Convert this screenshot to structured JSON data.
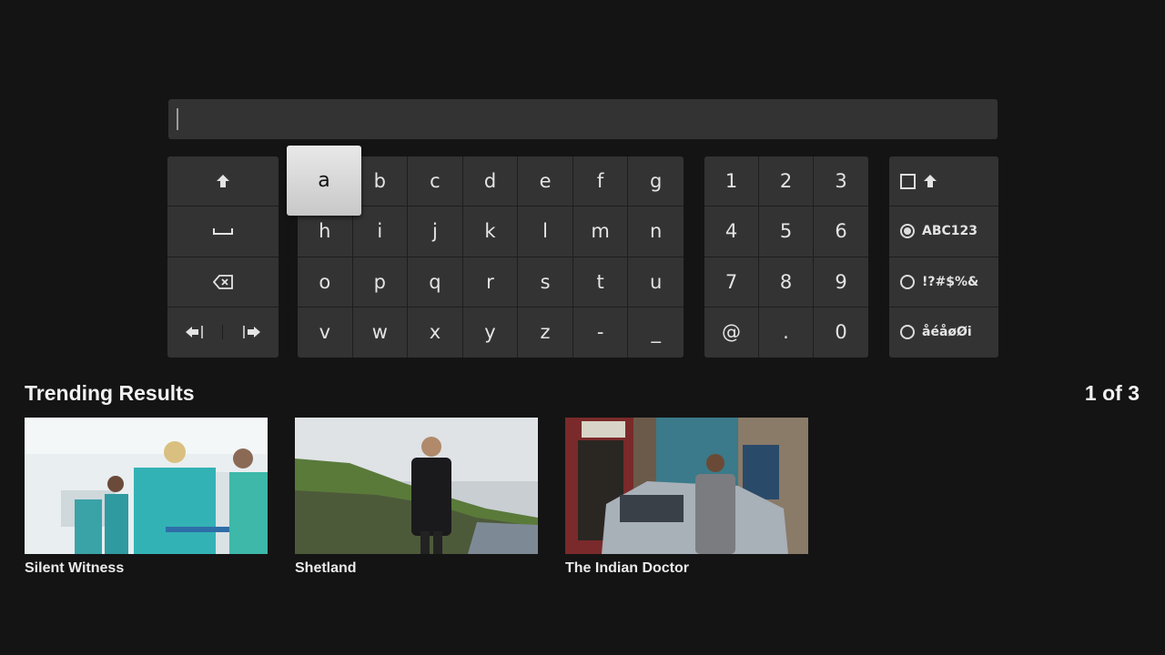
{
  "search": {
    "value": "",
    "placeholder": ""
  },
  "keyboard": {
    "focused_key": "a",
    "control_keys": {
      "shift_icon": "shift-arrow-icon",
      "space_icon": "space-icon",
      "backspace_icon": "backspace-icon",
      "cursor_left_icon": "cursor-left-icon",
      "cursor_right_icon": "cursor-right-icon"
    },
    "alpha_rows": [
      [
        "a",
        "b",
        "c",
        "d",
        "e",
        "f",
        "g"
      ],
      [
        "h",
        "i",
        "j",
        "k",
        "l",
        "m",
        "n"
      ],
      [
        "o",
        "p",
        "q",
        "r",
        "s",
        "t",
        "u"
      ],
      [
        "v",
        "w",
        "x",
        "y",
        "z",
        "-",
        "_"
      ]
    ],
    "number_rows": [
      [
        "1",
        "2",
        "3"
      ],
      [
        "4",
        "5",
        "6"
      ],
      [
        "7",
        "8",
        "9"
      ],
      [
        "@",
        ".",
        "0"
      ]
    ],
    "modes": [
      {
        "label": "ABC123",
        "selected": true
      },
      {
        "label": "!?#$%&",
        "selected": false
      },
      {
        "label": "åéåøØi",
        "selected": false
      }
    ]
  },
  "trending": {
    "title": "Trending Results",
    "page_count": "1 of 3",
    "items": [
      {
        "title": "Silent Witness"
      },
      {
        "title": "Shetland"
      },
      {
        "title": "The Indian Doctor"
      }
    ]
  },
  "colors": {
    "background": "#141414",
    "key": "#333333",
    "focus_key": "#d8d8d8",
    "text": "#e6e6e6"
  }
}
